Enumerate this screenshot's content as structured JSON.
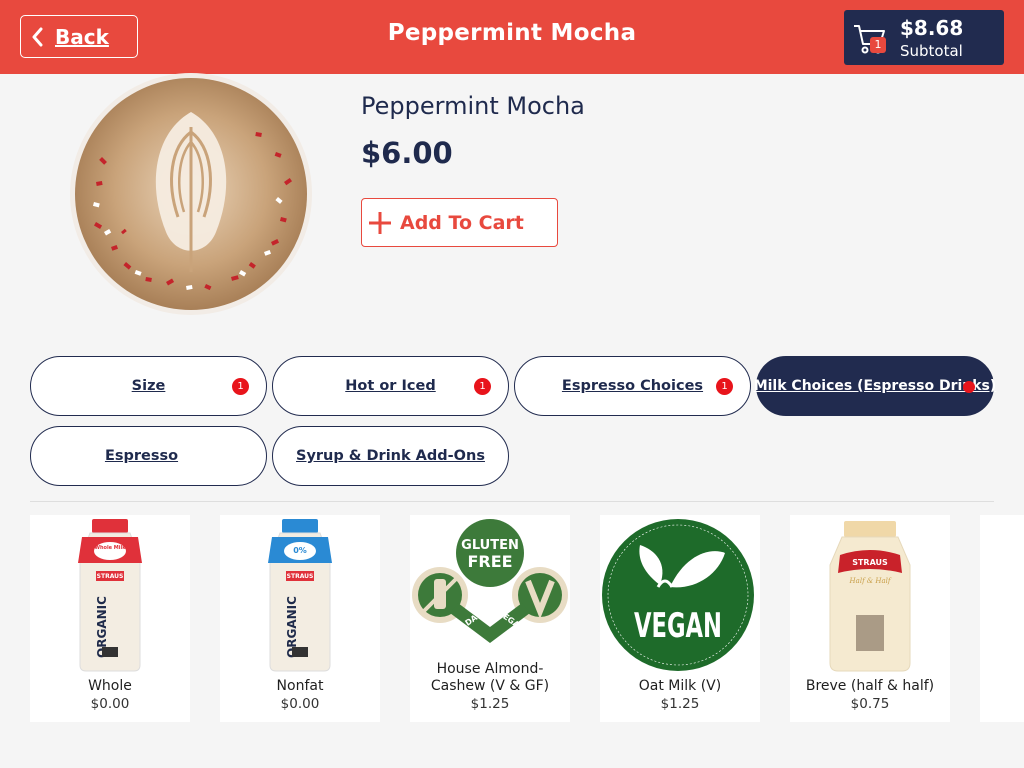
{
  "header": {
    "back_label": "Back",
    "title": "Peppermint Mocha",
    "cart": {
      "amount": "$8.68",
      "subtotal_label": "Subtotal",
      "count": "1"
    }
  },
  "product": {
    "name": "Peppermint Mocha",
    "price": "$6.00",
    "add_to_cart_label": "Add To Cart"
  },
  "tabs": [
    {
      "label": "Size",
      "badge": "1"
    },
    {
      "label": "Hot or Iced",
      "badge": "1"
    },
    {
      "label": "Espresso Choices",
      "badge": "1"
    },
    {
      "label": "Milk Choices (Espresso Drinks)",
      "badge": ""
    },
    {
      "label": "Espresso"
    },
    {
      "label": "Syrup & Drink Add-Ons"
    }
  ],
  "milk_options": [
    {
      "name": "Whole",
      "price": "$0.00",
      "bottle_label": "Whole Milk",
      "brand": "STRAUS",
      "side_text": "ORGANIC"
    },
    {
      "name": "Nonfat",
      "price": "$0.00",
      "bottle_label": "0%",
      "brand": "STRAUS",
      "side_text": "ORGANIC"
    },
    {
      "name": "House Almond-Cashew (V & GF)",
      "name_line1": "House Almond-",
      "name_line2": "Cashew (V & GF)",
      "price": "$1.25",
      "badge_text_1": "GLUTEN",
      "badge_text_2": "FREE",
      "badge_text_3": "NO DAIRY",
      "badge_text_4": "VEGAN"
    },
    {
      "name": "Oat Milk (V)",
      "price": "$1.25",
      "badge_text": "VEGAN"
    },
    {
      "name": "Breve (half & half)",
      "price": "$0.75",
      "brand": "STRAUS",
      "bottle_label": "Half & Half"
    }
  ],
  "colors": {
    "header_red": "#e8493e",
    "navy": "#212b4f",
    "badge_red": "#e8141b",
    "background": "#f5f5f5"
  }
}
